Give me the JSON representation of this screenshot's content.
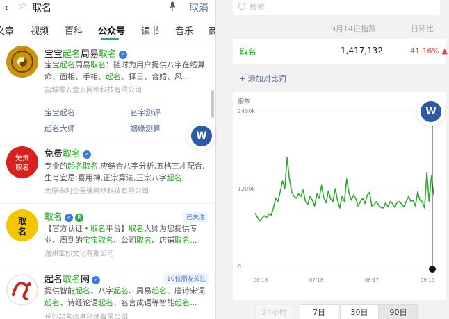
{
  "left": {
    "query": "取名",
    "cancel": "取消",
    "tabs": [
      "文章",
      "视频",
      "百科",
      "公众号",
      "读书",
      "音乐",
      "商"
    ],
    "results": [
      {
        "name_a": "宝宝",
        "name_b": "起名",
        "name_c": "周易",
        "name_d": "取名",
        "desc_parts": [
          "宝宝",
          "起名",
          "周易",
          "取名",
          "：随时为用户提供八字在线算命、面相、手相、",
          "起名",
          "、择日、合婚、风..."
        ],
        "org": "盐城零五壹五网络科技有限公司",
        "links": [
          "宝宝起名",
          "名字测评",
          "起名大师",
          "姻缘测算"
        ],
        "logo_text": "八字"
      },
      {
        "name_a": "免费",
        "name_b": "取名",
        "desc_parts": [
          "专业的",
          "起名取名",
          ",应结合八字分析,五格三才配合,生肖宜忌;喜用神,正宗算法,正宗八字",
          "起名",
          ",..."
        ],
        "org": "太原市利企吾通网络科技有限公司",
        "logo_text": "免费取名"
      },
      {
        "name_a": "取名",
        "badge": "已关注",
        "desc_parts": [
          "【官方认证・",
          "取名",
          "平台】",
          "取名",
          "大师为您提供专业、周到的",
          "宝宝取名",
          "、公司",
          "取名",
          "、店铺",
          "取名",
          "..."
        ],
        "org": "温州玄妙文化有限公司",
        "logo_text": "取名"
      },
      {
        "name_a": "起名",
        "name_b": "取名",
        "name_c": "网",
        "badge": "10位朋友关注",
        "desc_parts": [
          "提供智能",
          "起名",
          "、八字",
          "起名",
          "、周易",
          "起名",
          "、唐诗宋词",
          "起名",
          "、诗经论语",
          "起名",
          "，名言成语等智能",
          "起名",
          "..."
        ],
        "org": "长沙起名信息科技有限公司"
      }
    ]
  },
  "right": {
    "search_placeholder": "搜索",
    "col_date": "9月14日指数",
    "col_change": "日环比",
    "keyword": "取名",
    "index_value": "1,417,132",
    "change": "41.16%",
    "add_compare": "+ 添加对比词",
    "chart_label": "指数"
  },
  "chart_data": {
    "type": "line",
    "ylabel": "指数",
    "y_ticks": [
      "2400k",
      "1200k",
      "0"
    ],
    "ylim": [
      0,
      2400000
    ],
    "x_ticks": [
      "06-18",
      "07-18",
      "08-17",
      "09-15"
    ],
    "series": [
      {
        "values": [
          820000,
          760000,
          700000,
          740000,
          780000,
          750000,
          810000,
          790000,
          900000,
          1050000,
          1000000,
          1150000,
          1320000,
          1200000,
          1680000,
          1350000,
          1150000,
          1080000,
          1050000,
          1120000,
          1080000,
          1180000,
          1000000,
          950000,
          1080000,
          1020000,
          930000,
          1120000,
          1050000,
          1250000,
          1060000,
          980000,
          1160000,
          1040000,
          1000000,
          1200000,
          1020000,
          900000,
          1080000,
          1000000,
          1350000,
          1130000,
          1020000,
          1100000,
          1040000,
          930000,
          1000000,
          1050000,
          970000,
          1100000,
          1140000,
          930000,
          950000,
          1000000,
          940000,
          910000,
          900000,
          980000,
          920000,
          1000000,
          970000,
          910000,
          990000,
          1000000,
          960000,
          920000,
          1000000,
          1080000,
          1000000,
          1020000,
          930000,
          1150000,
          1020000,
          1000000,
          900000,
          1450000,
          1000000,
          1400000,
          1100000
        ]
      }
    ]
  },
  "periods": [
    "24小时",
    "7日",
    "30日",
    "90日"
  ],
  "colors": {
    "accent": "#1aad19",
    "link": "#576b95",
    "up": "#e64340",
    "line": "#2daa2d"
  },
  "float_btn": "W"
}
